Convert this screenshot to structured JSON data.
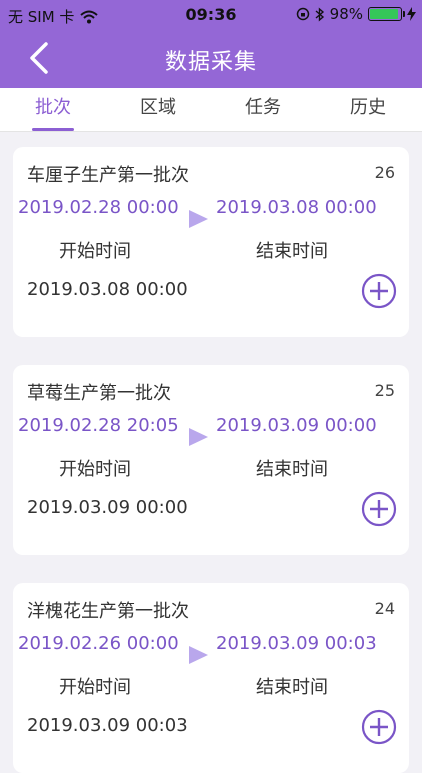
{
  "status": {
    "carrier": "无 SIM 卡",
    "time": "09:36",
    "battery": "98%",
    "battery_level": 0.98
  },
  "nav": {
    "title": "数据采集"
  },
  "tabs": [
    {
      "label": "批次",
      "active": true
    },
    {
      "label": "区域",
      "active": false
    },
    {
      "label": "任务",
      "active": false
    },
    {
      "label": "历史",
      "active": false
    }
  ],
  "batches": [
    {
      "name": "车厘子生产第一批次",
      "count": "26",
      "start_time": "2019.02.28 00:00",
      "end_time": "2019.03.08 00:00",
      "start_label": "开始时间",
      "end_label": "结束时间",
      "date": "2019.03.08 00:00"
    },
    {
      "name": "草莓生产第一批次",
      "count": "25",
      "start_time": "2019.02.28 20:05",
      "end_time": "2019.03.09 00:00",
      "start_label": "开始时间",
      "end_label": "结束时间",
      "date": "2019.03.09 00:00"
    },
    {
      "name": "洋槐花生产第一批次",
      "count": "24",
      "start_time": "2019.02.26 00:00",
      "end_time": "2019.03.09 00:03",
      "start_label": "开始时间",
      "end_label": "结束时间",
      "date": "2019.03.09 00:03"
    }
  ],
  "colors": {
    "header": "#9467d6",
    "accent": "#8c5fd3",
    "background": "#f2f1f6"
  }
}
